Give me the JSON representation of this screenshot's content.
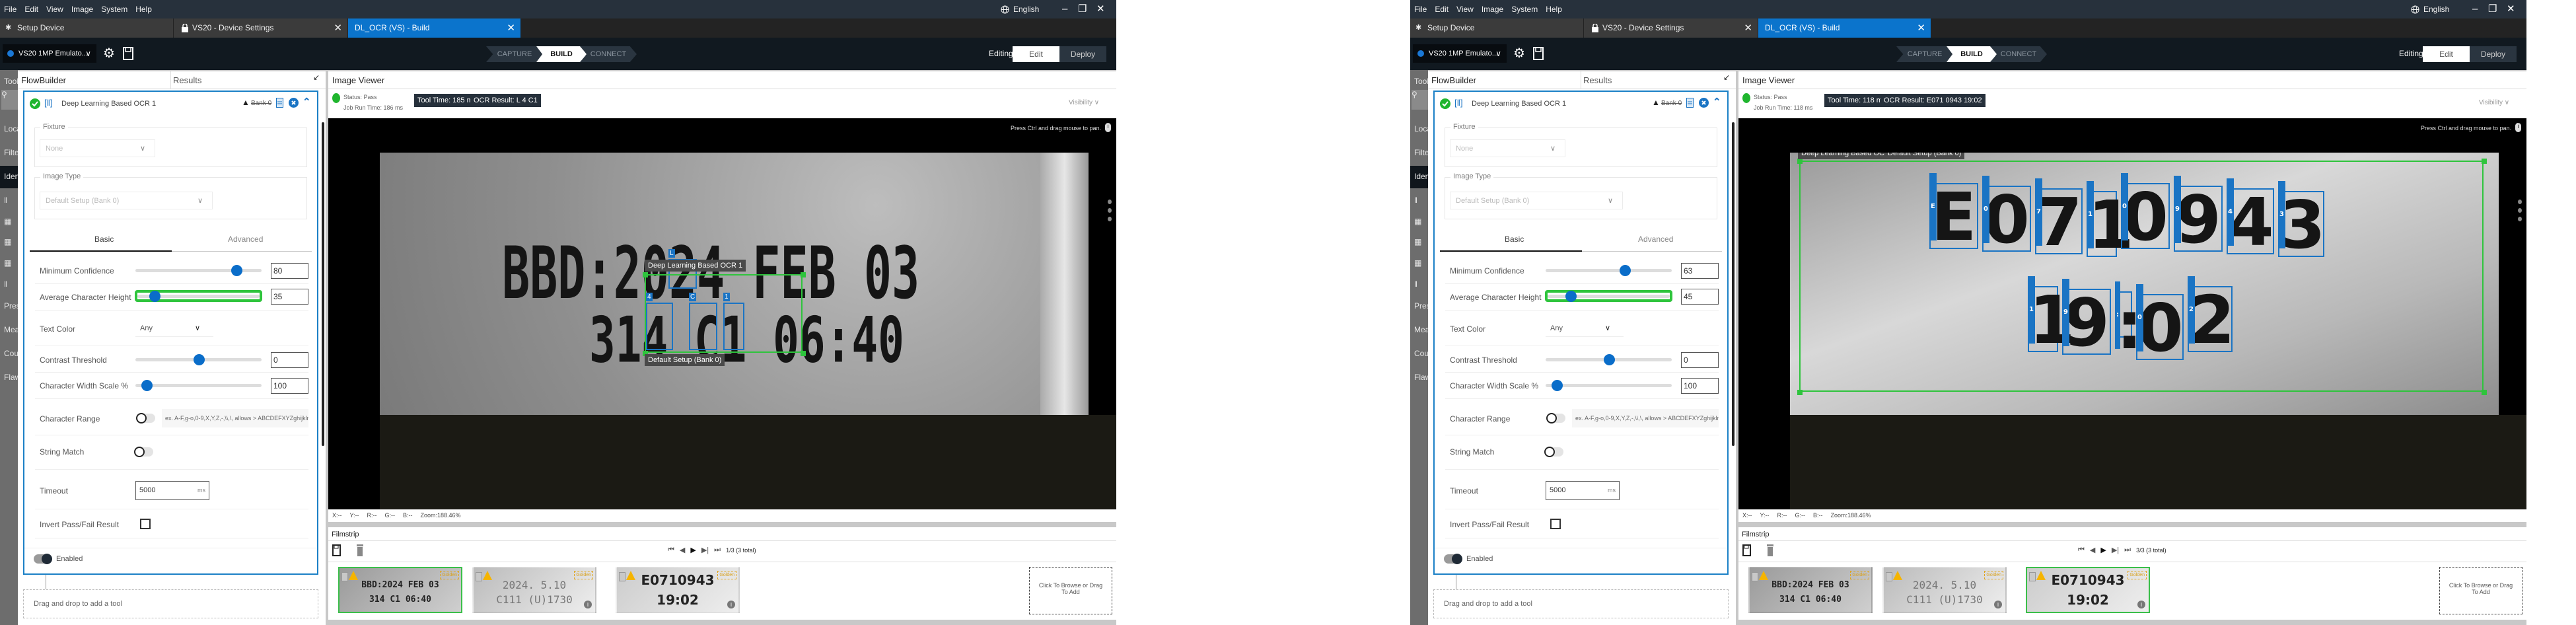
{
  "windows": [
    {
      "menu": [
        "File",
        "Edit",
        "View",
        "Image",
        "System",
        "Help"
      ],
      "language": "English",
      "tabs": [
        {
          "label": "Setup Device"
        },
        {
          "label": "VS20 - Device Settings"
        },
        {
          "label": "DL_OCR  (VS) - Build"
        }
      ],
      "device": "VS20 1MP Emulato...",
      "steps": [
        "CAPTURE",
        "BUILD",
        "CONNECT"
      ],
      "editing_label": "Editing",
      "edit_label": "Edit",
      "deploy_label": "Deploy",
      "tools_sidebar": [
        "Tools",
        "Loca",
        "Filte",
        "Iden",
        "Pres",
        "Mea",
        "Cou",
        "Flaw"
      ],
      "flowbuilder": {
        "title": "FlowBuilder",
        "results_tab": "Results",
        "tool_name": "Deep Learning Based OCR 1",
        "bank": "Bank 0",
        "fixture_label": "Fixture",
        "fixture_value": "None",
        "image_type_label": "Image Type",
        "image_type_value": "Default Setup (Bank 0)",
        "tabs": [
          "Basic",
          "Advanced"
        ],
        "min_confidence": {
          "label": "Minimum Confidence",
          "value": "80",
          "position": 0.8
        },
        "avg_char_height": {
          "label": "Average Character Height",
          "value": "35",
          "position": 0.14
        },
        "text_color": {
          "label": "Text Color",
          "value": "Any"
        },
        "contrast": {
          "label": "Contrast Threshold",
          "value": "0",
          "position": 0.5
        },
        "width_scale": {
          "label": "Character Width Scale %",
          "value": "100",
          "position": 0.09
        },
        "char_range": {
          "label": "Character Range",
          "hint": "ex. A-F,g-o,0-9,X,Y,Z,-,\\\\,\\,  allows >  ABCDEFXYZghijkln",
          "enabled": false
        },
        "string_match": {
          "label": "String Match",
          "enabled": false
        },
        "timeout": {
          "label": "Timeout",
          "value": "5000",
          "unit": "ms"
        },
        "invert": {
          "label": "Invert Pass/Fail Result",
          "checked": false
        },
        "enabled_label": "Enabled",
        "drop_hint": "Drag and drop to add a tool"
      },
      "viewer": {
        "title": "Image Viewer",
        "status": "Status:  Pass",
        "job_run_time": "Job Run Time: 186 ms",
        "tool_time": "Tool Time: 185 ms",
        "ocr_result": "OCR Result: L 4 C1",
        "visibility": "Visibility",
        "pan_hint": "Press Ctrl and drag mouse to pan.",
        "tool_tag": "Deep Learning Based OCR 1",
        "bank_tag": "Default Setup (Bank 0)",
        "image_lines": [
          "BBD:2024 FEB 03",
          "314 C1 06:40"
        ],
        "detections": [
          "L",
          "4",
          "C",
          "1"
        ],
        "statusbar": [
          "X:--",
          "Y:--",
          "R:--",
          "G:--",
          "B:--",
          "Zoom:188.46%"
        ]
      },
      "filmstrip": {
        "title": "Filmstrip",
        "counter": "1/3 (3 total)",
        "selected": 0,
        "thumbs": [
          {
            "lines": [
              "BBD:2024 FEB 03",
              "314 C1 06:40"
            ],
            "badge": "Golden"
          },
          {
            "lines": [
              "2024.  5.10",
              "C111 (U)1730"
            ],
            "badge": "Golden"
          },
          {
            "lines": [
              "E0710943",
              "19:02"
            ],
            "badge": "Golden"
          }
        ],
        "drop_label": "Click To Browse or Drag To Add"
      }
    },
    {
      "menu": [
        "File",
        "Edit",
        "View",
        "Image",
        "System",
        "Help"
      ],
      "language": "English",
      "tabs": [
        {
          "label": "Setup Device"
        },
        {
          "label": "VS20 - Device Settings"
        },
        {
          "label": "DL_OCR  (VS) - Build"
        }
      ],
      "device": "VS20 1MP Emulato...",
      "steps": [
        "CAPTURE",
        "BUILD",
        "CONNECT"
      ],
      "editing_label": "Editing",
      "edit_label": "Edit",
      "deploy_label": "Deploy",
      "tools_sidebar": [
        "Tools",
        "Loca",
        "Filte",
        "Iden",
        "Pres",
        "Mea",
        "Cou",
        "Flaw"
      ],
      "flowbuilder": {
        "title": "FlowBuilder",
        "results_tab": "Results",
        "tool_name": "Deep Learning Based OCR 1",
        "bank": "Bank 0",
        "fixture_label": "Fixture",
        "fixture_value": "None",
        "image_type_label": "Image Type",
        "image_type_value": "Default Setup (Bank 0)",
        "tabs": [
          "Basic",
          "Advanced"
        ],
        "min_confidence": {
          "label": "Minimum Confidence",
          "value": "63",
          "position": 0.63
        },
        "avg_char_height": {
          "label": "Average Character Height",
          "value": "45",
          "position": 0.19
        },
        "text_color": {
          "label": "Text Color",
          "value": "Any"
        },
        "contrast": {
          "label": "Contrast Threshold",
          "value": "0",
          "position": 0.5
        },
        "width_scale": {
          "label": "Character Width Scale %",
          "value": "100",
          "position": 0.09
        },
        "char_range": {
          "label": "Character Range",
          "hint": "ex. A-F,g-o,0-9,X,Y,Z,-,\\\\,\\,  allows >  ABCDEFXYZghijkln",
          "enabled": false
        },
        "string_match": {
          "label": "String Match",
          "enabled": false
        },
        "timeout": {
          "label": "Timeout",
          "value": "5000",
          "unit": "ms"
        },
        "invert": {
          "label": "Invert Pass/Fail Result",
          "checked": false
        },
        "enabled_label": "Enabled",
        "drop_hint": "Drag and drop to add a tool"
      },
      "viewer": {
        "title": "Image Viewer",
        "status": "Status:  Pass",
        "job_run_time": "Job Run Time: 118 ms",
        "tool_time": "Tool Time: 118 ms",
        "ocr_result": "OCR Result: E071 0943 19:02",
        "visibility": "Visibility",
        "pan_hint": "Press Ctrl and drag mouse to pan.",
        "tool_tag": "Deep Learning Based OCR 1",
        "bank_tag": "Default Setup (Bank 0)",
        "image_lines": [
          "E0710943",
          "19:02"
        ],
        "detections": [
          "E",
          "0",
          "7",
          "1",
          "0",
          "9",
          "4",
          "3",
          "1",
          "9",
          ":",
          "0",
          "2"
        ],
        "statusbar": [
          "X:--",
          "Y:--",
          "R:--",
          "G:--",
          "B:--",
          "Zoom:188.46%"
        ]
      },
      "filmstrip": {
        "title": "Filmstrip",
        "counter": "3/3 (3 total)",
        "selected": 2,
        "thumbs": [
          {
            "lines": [
              "BBD:2024 FEB 03",
              "314 C1 06:40"
            ],
            "badge": "Golden"
          },
          {
            "lines": [
              "2024.  5.10",
              "C111 (U)1730"
            ],
            "badge": "Golden"
          },
          {
            "lines": [
              "E0710943",
              "19:02"
            ],
            "badge": "Golden"
          }
        ],
        "drop_label": "Click To Browse or Drag To Add"
      }
    }
  ],
  "colors": {
    "accent": "#0b74cc",
    "pass": "#1fb52e",
    "roi": "#2ec43c",
    "detection": "#1a74c4"
  }
}
